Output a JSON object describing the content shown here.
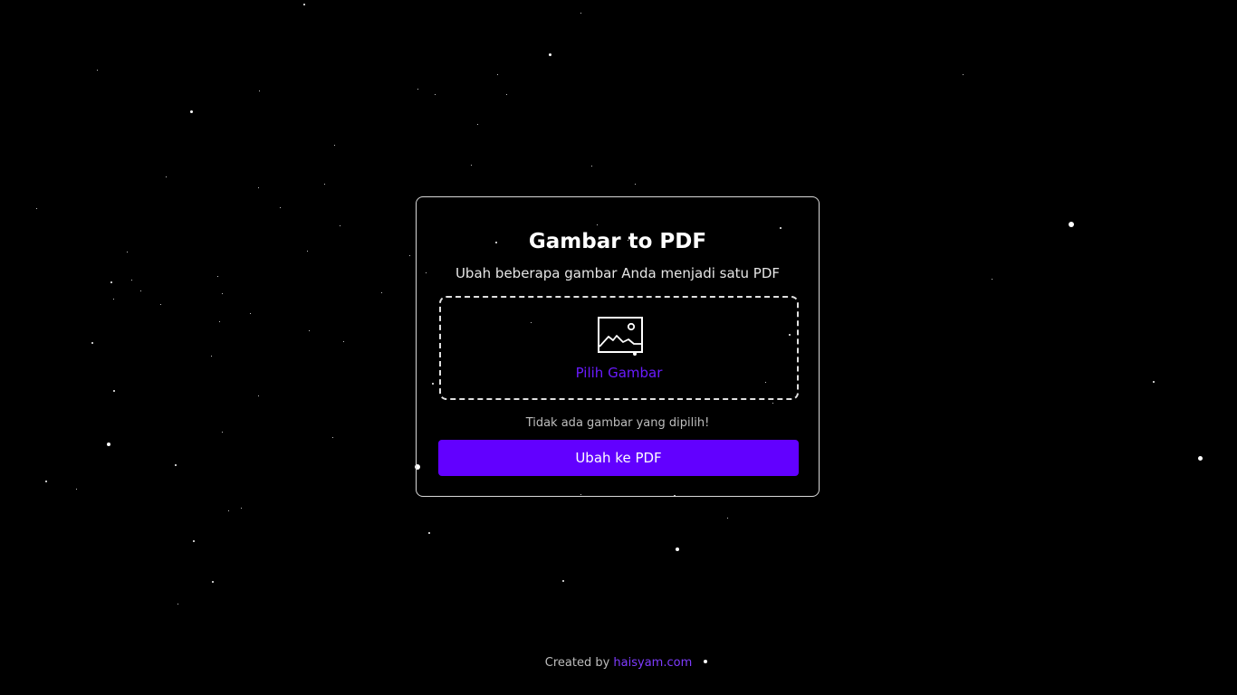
{
  "app": {
    "title": "Gambar to PDF",
    "subtitle": "Ubah beberapa gambar Anda menjadi satu PDF"
  },
  "dropzone": {
    "icon": "image-icon",
    "label": "Pilih Gambar"
  },
  "status": {
    "text": "Tidak ada gambar yang dipilih!"
  },
  "actions": {
    "convert_label": "Ubah ke PDF"
  },
  "footer": {
    "prefix": "Created by",
    "link_text": "haisyam.com"
  },
  "colors": {
    "background": "#000000",
    "accent": "#6200ff",
    "link": "#7f3cff",
    "text": "#ffffff",
    "muted": "#bdbdbd"
  }
}
